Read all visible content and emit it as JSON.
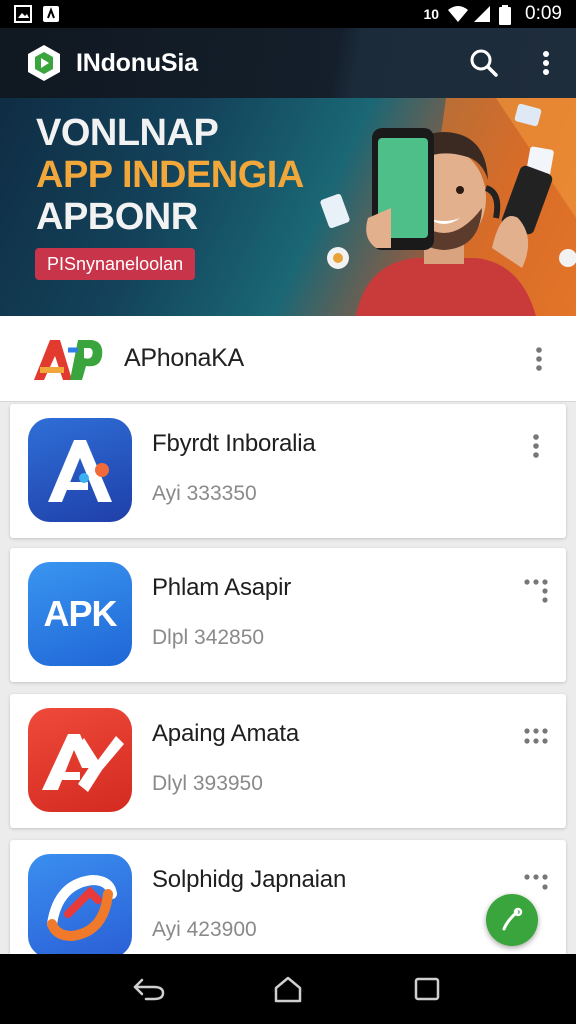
{
  "status_bar": {
    "time": "0:09",
    "icons": [
      "gallery-icon",
      "notification-icon",
      "vibrate-icon",
      "wifi-icon",
      "signal-icon",
      "battery-icon"
    ]
  },
  "app_bar": {
    "title": "INdonuSia",
    "actions": [
      "search-icon",
      "more-vert-icon"
    ]
  },
  "banner": {
    "line1": "VONLNAP",
    "line2": "APP INDENGIA",
    "line3": "APBONR",
    "button": "PISnynaneloolan"
  },
  "featured": {
    "title": "APhonaKA"
  },
  "apps": [
    {
      "name": "Fbyrdt Inboralia",
      "meta": "Ayi 333350",
      "more": "more-vert-icon"
    },
    {
      "name": "Phlam Asapir",
      "meta": "Dlpl 342850",
      "more": "more-grid-icon"
    },
    {
      "name": "Apaing Amata",
      "meta": "Dlyl 393950",
      "more": "more-grid-icon"
    },
    {
      "name": "Solphidg Japnaian",
      "meta": "Ayi 423900",
      "more": "more-grid-icon"
    }
  ],
  "app_icons": {
    "app1_text": "A",
    "app2_text": "APK",
    "app3_text": "AY"
  },
  "nav": [
    "back-icon",
    "home-icon",
    "recents-icon"
  ],
  "colors": {
    "app_bar": "#141f2b",
    "accent_green": "#3aa43d",
    "banner_pill": "#c8344a",
    "apk_blue": "#2f7fe6",
    "red": "#e23a2e"
  }
}
